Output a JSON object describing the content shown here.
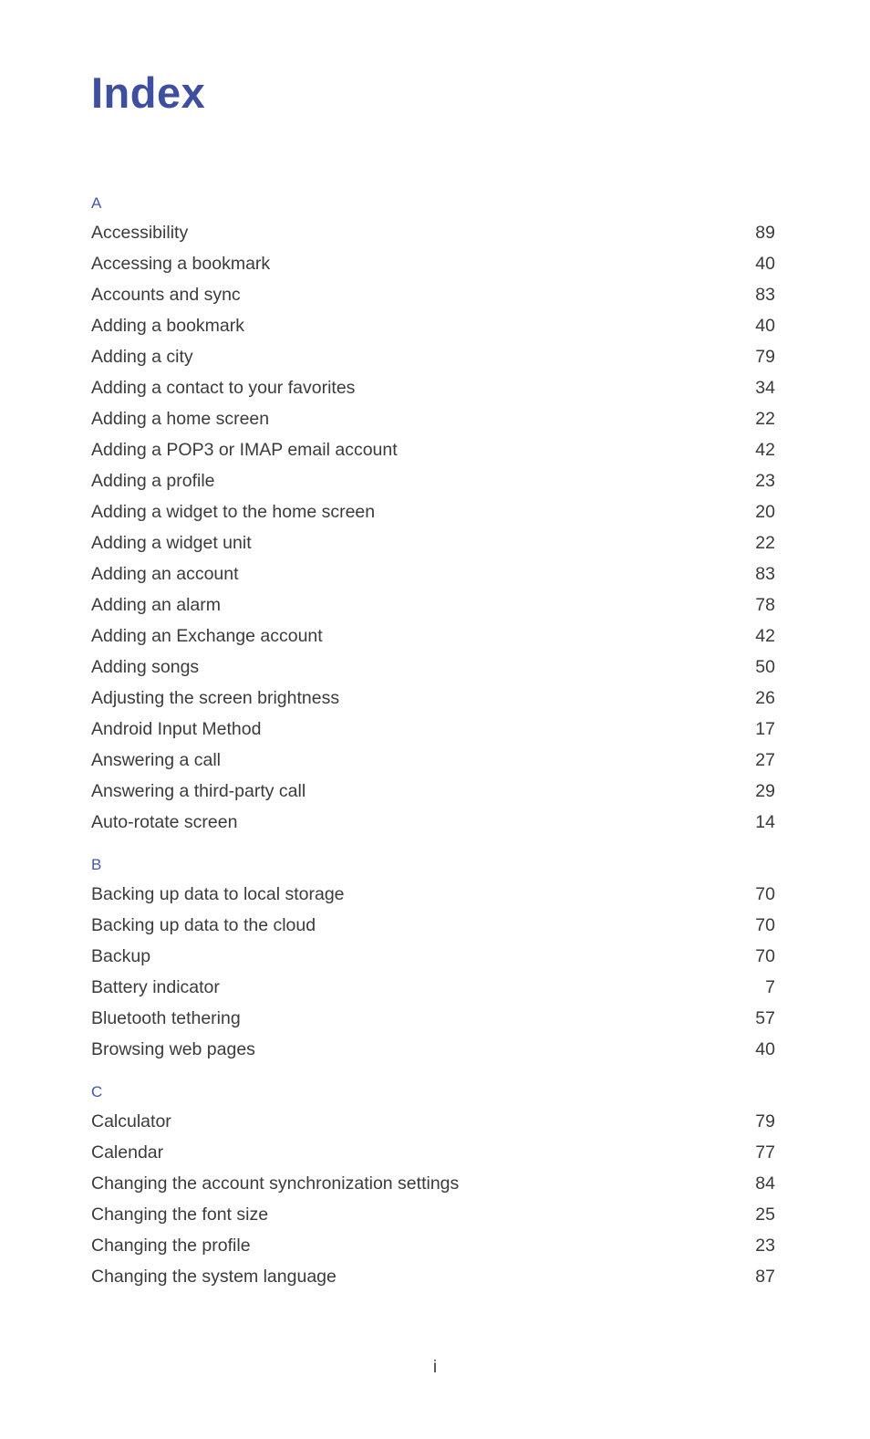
{
  "document": {
    "title": "Index",
    "footer_page_number": "i",
    "colors": {
      "title": "#3f4fa0",
      "section_letter": "#4356ab",
      "body_text": "#3b3b3b",
      "background": "#ffffff"
    }
  },
  "sections": [
    {
      "letter": "A",
      "entries": [
        {
          "label": "Accessibility",
          "page": "89"
        },
        {
          "label": "Accessing a bookmark",
          "page": "40"
        },
        {
          "label": "Accounts and sync",
          "page": "83"
        },
        {
          "label": "Adding a bookmark",
          "page": "40"
        },
        {
          "label": "Adding a city",
          "page": "79"
        },
        {
          "label": "Adding a contact to your favorites",
          "page": "34"
        },
        {
          "label": "Adding a home screen",
          "page": "22"
        },
        {
          "label": "Adding a POP3 or IMAP email account",
          "page": "42"
        },
        {
          "label": "Adding a profile",
          "page": "23"
        },
        {
          "label": "Adding a widget to the home screen",
          "page": "20"
        },
        {
          "label": "Adding a widget unit",
          "page": "22"
        },
        {
          "label": "Adding an account",
          "page": "83"
        },
        {
          "label": "Adding an alarm",
          "page": "78"
        },
        {
          "label": "Adding an Exchange account",
          "page": "42"
        },
        {
          "label": "Adding songs",
          "page": "50"
        },
        {
          "label": "Adjusting the screen brightness",
          "page": "26"
        },
        {
          "label": "Android Input Method",
          "page": "17"
        },
        {
          "label": "Answering a call",
          "page": "27"
        },
        {
          "label": "Answering a third-party call",
          "page": "29"
        },
        {
          "label": "Auto-rotate screen",
          "page": "14"
        }
      ]
    },
    {
      "letter": "B",
      "entries": [
        {
          "label": "Backing up data to local storage",
          "page": "70"
        },
        {
          "label": "Backing up data to the cloud",
          "page": "70"
        },
        {
          "label": "Backup",
          "page": "70"
        },
        {
          "label": "Battery indicator",
          "page": "7"
        },
        {
          "label": "Bluetooth tethering",
          "page": "57"
        },
        {
          "label": "Browsing web pages",
          "page": "40"
        }
      ]
    },
    {
      "letter": "C",
      "entries": [
        {
          "label": "Calculator",
          "page": "79"
        },
        {
          "label": "Calendar",
          "page": "77"
        },
        {
          "label": "Changing the account synchronization settings",
          "page": "84"
        },
        {
          "label": "Changing the font size",
          "page": "25"
        },
        {
          "label": "Changing the profile",
          "page": "23"
        },
        {
          "label": "Changing the system language",
          "page": "87"
        }
      ]
    }
  ]
}
